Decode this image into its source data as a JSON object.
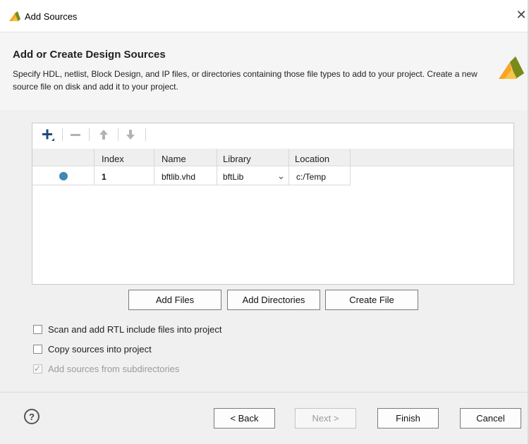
{
  "window": {
    "title": "Add Sources",
    "close_icon": "close-icon",
    "app_icon": "vivado-logo-icon"
  },
  "header": {
    "title": "Add or Create Design Sources",
    "description": "Specify HDL, netlist, Block Design, and IP files, or directories containing those file types to add to your project. Create a new source file on disk and add it to your project."
  },
  "toolbar": {
    "icons": [
      "add-icon",
      "remove-icon",
      "move-up-icon",
      "move-down-icon"
    ]
  },
  "table": {
    "columns": [
      "Index",
      "Name",
      "Library",
      "Location"
    ],
    "rows": [
      {
        "status": "source-dot-icon",
        "index": "1",
        "name": "bftlib.vhd",
        "library": "bftLib",
        "location": "c:/Temp"
      }
    ]
  },
  "actions": {
    "add_files": "Add Files",
    "add_directories": "Add Directories",
    "create_file": "Create File"
  },
  "options": {
    "scan_rtl": {
      "label": "Scan and add RTL include files into project",
      "checked": false,
      "enabled": true
    },
    "copy_sources": {
      "label": "Copy sources into project",
      "checked": false,
      "enabled": true
    },
    "add_subdirs": {
      "label": "Add sources from subdirectories",
      "checked": true,
      "enabled": false
    }
  },
  "footer": {
    "help": "?",
    "back": "< Back",
    "next": "Next >",
    "finish": "Finish",
    "cancel": "Cancel"
  },
  "colors": {
    "accent": "#3f88b4",
    "logo_light": "#f5a623",
    "logo_dark": "#6e7a1c",
    "header_bg": "#f5f5f5",
    "panel_bg": "#f0f0f0"
  }
}
